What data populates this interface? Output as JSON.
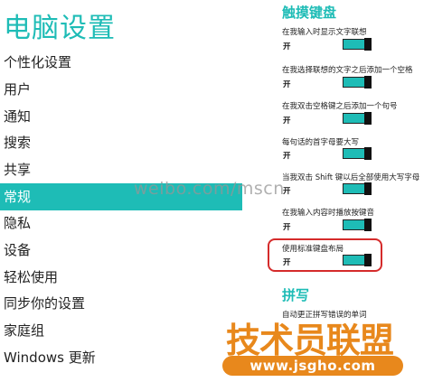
{
  "left": {
    "title": "电脑设置",
    "items": [
      "个性化设置",
      "用户",
      "通知",
      "搜索",
      "共享",
      "常规",
      "隐私",
      "设备",
      "轻松使用",
      "同步你的设置",
      "家庭组",
      "Windows 更新"
    ],
    "selected_index": 5
  },
  "right": {
    "section_touch": "触摸键盘",
    "settings": [
      {
        "label": "在我输入时显示文字联想",
        "state": "开"
      },
      {
        "label": "在我选择联想的文字之后添加一个空格",
        "state": "开"
      },
      {
        "label": "在我双击空格键之后添加一个句号",
        "state": "开"
      },
      {
        "label": "每句话的首字母要大写",
        "state": "开"
      },
      {
        "label": "当我双击 Shift 键以后全部使用大写字母",
        "state": "开"
      },
      {
        "label": "在我输入内容时播放按键音",
        "state": "开"
      },
      {
        "label": "使用标准键盘布局",
        "state": "开"
      }
    ],
    "section_spell": "拼写",
    "spell_label": "自动更正拼写错误的单词"
  },
  "watermarks": {
    "weibo": "weibo.com/mscn",
    "site_name": "技术员联盟",
    "site_url": "www.jsgho.com"
  },
  "colors": {
    "accent": "#1ebcb6",
    "highlight": "#d52b2b",
    "watermark": "#e8881c"
  }
}
